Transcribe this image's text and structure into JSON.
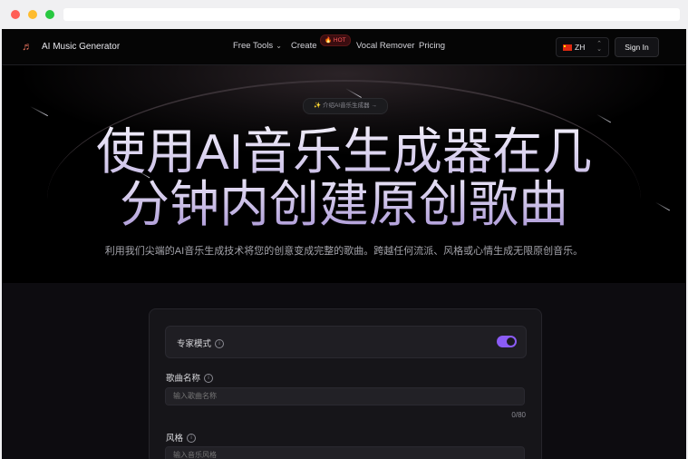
{
  "app": {
    "brand_name": "AI Music Generator",
    "brand_icon": "music-note-icon"
  },
  "nav": {
    "free_tools": "Free Tools",
    "create": "Create",
    "hot_badge": "🔥 HOT",
    "vocal_remover": "Vocal Remover",
    "pricing": "Pricing"
  },
  "lang": {
    "code": "ZH",
    "flag": "china-flag-icon"
  },
  "auth": {
    "sign_in": "Sign In"
  },
  "hero": {
    "pill": "✨ 介绍AI音乐生成器 →",
    "title_line1": "使用AI音乐生成器在几",
    "title_line2": "分钟内创建原创歌曲",
    "subtitle": "利用我们尖端的AI音乐生成技术将您的创意变成完整的歌曲。跨越任何流派、风格或心情生成无限原创音乐。"
  },
  "form": {
    "expert_mode_label": "专家模式",
    "expert_mode_on": true,
    "song_name_label": "歌曲名称",
    "song_name_placeholder": "输入歌曲名称",
    "song_name_counter": "0/80",
    "style_label": "风格",
    "style_placeholder": "输入音乐风格"
  },
  "colors": {
    "accent": "#8b5cf6",
    "background": "#000000",
    "hot": "#ff5a5a"
  }
}
